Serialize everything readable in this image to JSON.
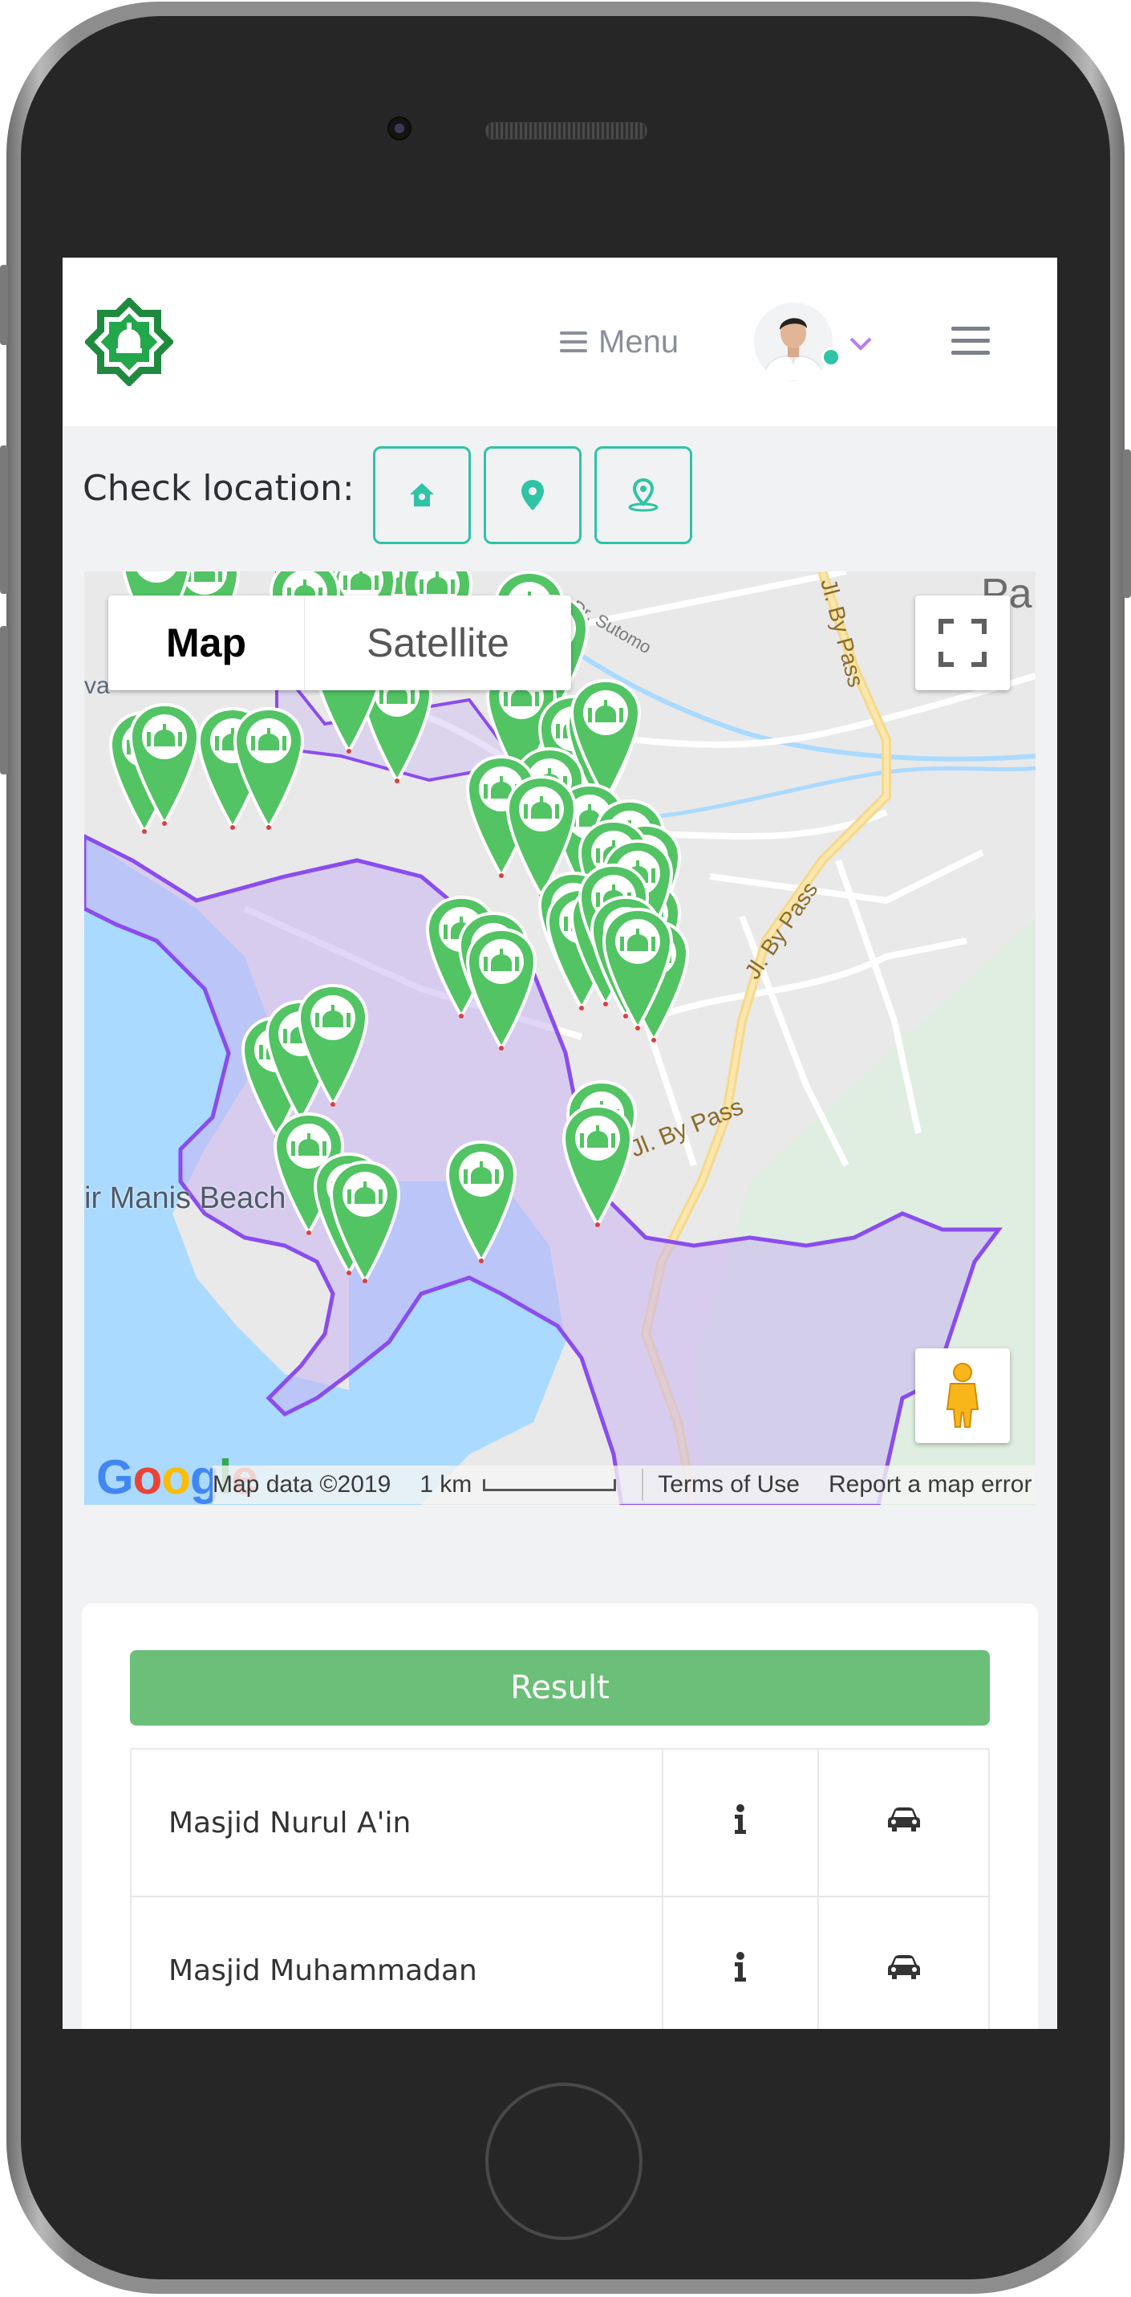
{
  "header": {
    "menu_label": "Menu",
    "logo_name": "mosque-app-logo",
    "user_avatar": "user-avatar",
    "online_color": "#2ec4a5"
  },
  "check_location": {
    "label": "Check location:",
    "buttons": [
      "home-location-icon",
      "pin-location-icon",
      "my-location-icon"
    ],
    "accent_color": "#2ec4a5"
  },
  "map": {
    "type_buttons": {
      "map": "Map",
      "satellite": "Satellite"
    },
    "selected_type": "Map",
    "google_logo": "Google",
    "footer": {
      "map_data": "Map data ©2019",
      "scale": "1 km",
      "terms": "Terms of Use",
      "report": "Report a map error"
    },
    "labels": {
      "place_fragment": "ir Manis Beach",
      "road1": "Jl. By Pass",
      "road2": "Jl. By Pass",
      "road3": "Jl. By Pass",
      "street": "Dr. Sutomo",
      "corner": "Pa",
      "edge": "va"
    },
    "marker_color": "#52c463",
    "region_color": "#b99ef0",
    "boundary_color": "#8a4cf0"
  },
  "results": {
    "button_label": "Result",
    "button_color": "#6bbf79",
    "rows": [
      {
        "name": "Masjid Nurul A'in",
        "info_icon": "info-icon",
        "route_icon": "car-icon"
      },
      {
        "name": "Masjid Muhammadan",
        "info_icon": "info-icon",
        "route_icon": "car-icon"
      }
    ]
  }
}
